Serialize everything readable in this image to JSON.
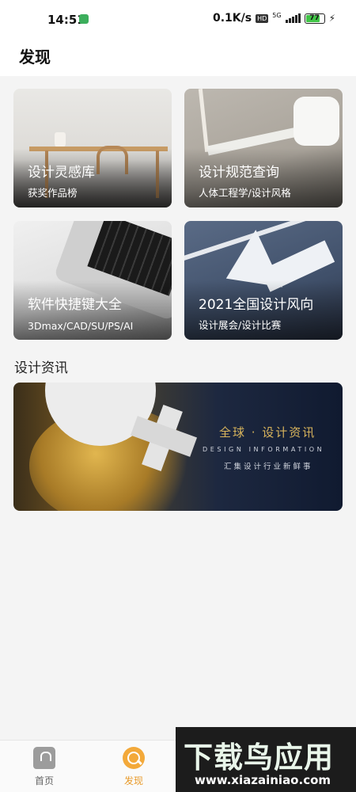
{
  "status_bar": {
    "time": "14:51",
    "net_speed": "0.1K/s",
    "hd_badge": "HD",
    "net_type": "5G",
    "battery": "77"
  },
  "header": {
    "title": "发现"
  },
  "cards": [
    {
      "title": "设计灵感库",
      "subtitle": "获奖作品榜"
    },
    {
      "title": "设计规范查询",
      "subtitle": "人体工程学/设计风格"
    },
    {
      "title": "软件快捷键大全",
      "subtitle": "3Dmax/CAD/SU/PS/AI"
    },
    {
      "title": "2021全国设计风向",
      "subtitle": "设计展会/设计比赛"
    }
  ],
  "section": {
    "title": "设计资讯"
  },
  "banner": {
    "title": "全球 · 设计资讯",
    "english": "DESIGN INFORMATION",
    "subtitle": "汇集设计行业新鲜事"
  },
  "bottom_nav": [
    {
      "label": "首页",
      "icon": "home-icon"
    },
    {
      "label": "发现",
      "icon": "search-icon",
      "active": true
    }
  ],
  "watermark": {
    "title": "下载鸟应用",
    "url": "www.xiazainiao.com"
  },
  "colors": {
    "accent": "#e89a2a",
    "background": "#f4f4f4"
  }
}
